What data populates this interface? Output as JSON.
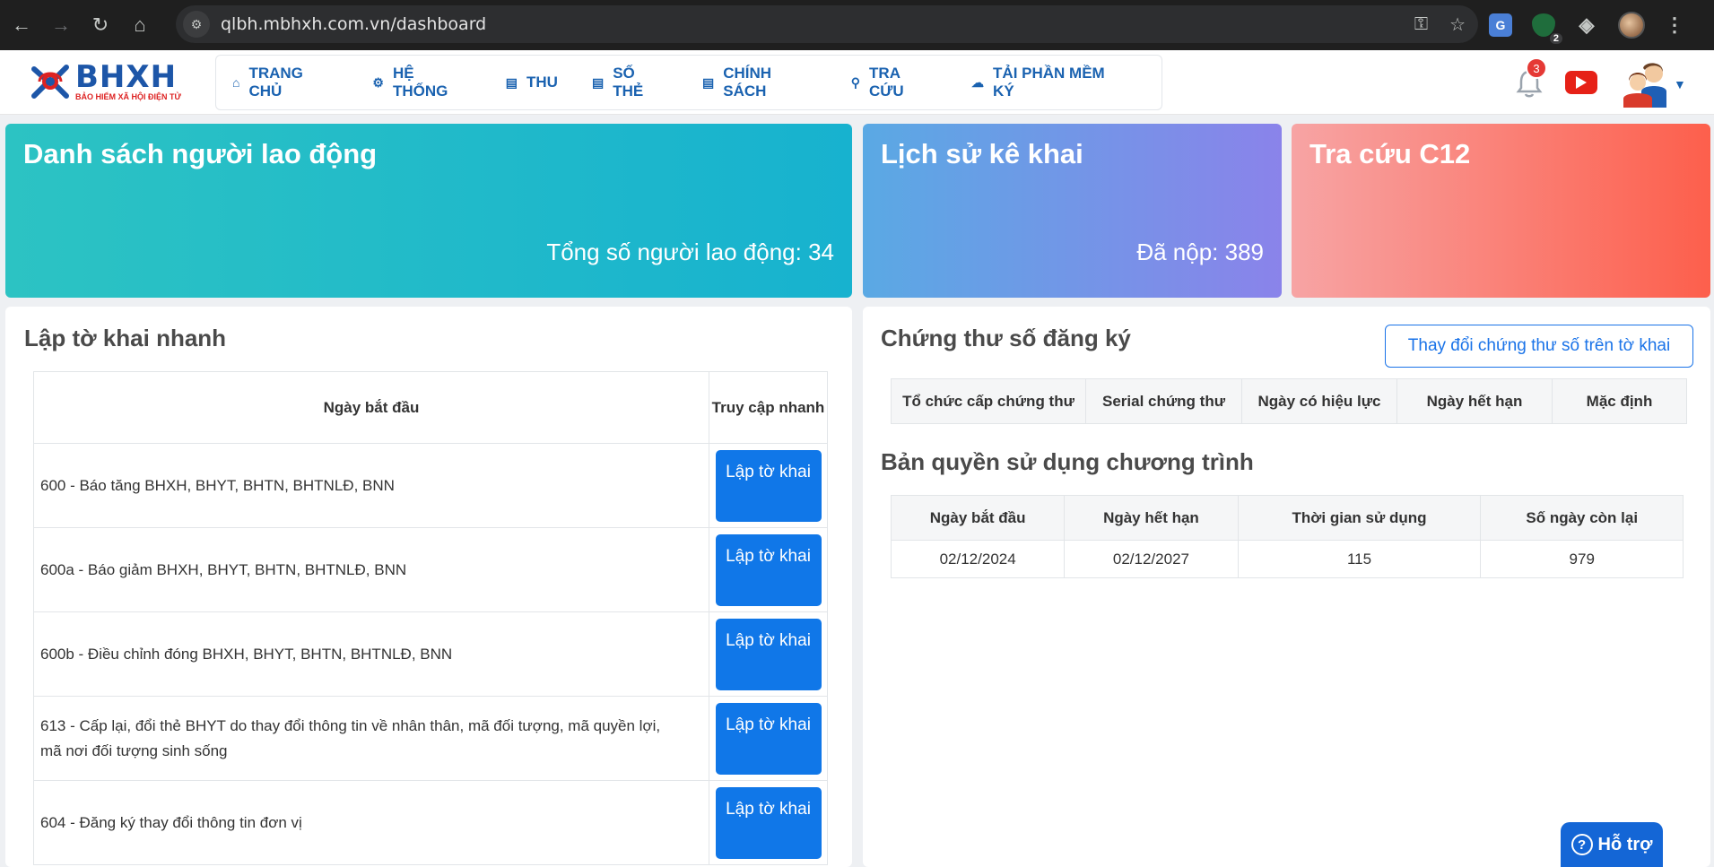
{
  "browser": {
    "url": "qlbh.mbhxh.com.vn/dashboard",
    "extension_badge": "2"
  },
  "header": {
    "logo_text": "BHXH",
    "logo_subtext": "BẢO HIỂM XÃ HỘI ĐIỆN TỬ",
    "menu": [
      {
        "label": "TRANG CHỦ",
        "icon": "home-icon"
      },
      {
        "label": "HỆ THỐNG",
        "icon": "gear-icon"
      },
      {
        "label": "THU",
        "icon": "document-icon"
      },
      {
        "label": "SỐ THẺ",
        "icon": "document-icon"
      },
      {
        "label": "CHÍNH SÁCH",
        "icon": "document-icon"
      },
      {
        "label": "TRA CỨU",
        "icon": "search-icon"
      },
      {
        "label": "TẢI PHẦN MỀM KÝ",
        "icon": "cloud-upload-icon"
      }
    ],
    "notification_count": "3"
  },
  "cards": {
    "workers": {
      "title": "Danh sách người lao động",
      "value": "Tổng số người lao động: 34"
    },
    "history": {
      "title": "Lịch sử kê khai",
      "value": "Đã nộp: 389"
    },
    "c12": {
      "title": "Tra cứu C12"
    }
  },
  "quick_form": {
    "title": "Lập tờ khai nhanh",
    "col_name": "Ngày bắt đầu",
    "col_action": "Truy cập nhanh",
    "button_label": "Lập tờ khai",
    "rows": [
      "600 - Báo tăng BHXH, BHYT, BHTN, BHTNLĐ, BNN",
      "600a - Báo giảm BHXH, BHYT, BHTN, BHTNLĐ, BNN",
      "600b - Điều chỉnh đóng BHXH, BHYT, BHTN, BHTNLĐ, BNN",
      "613 - Cấp lại, đổi thẻ BHYT do thay đổi thông tin về nhân thân, mã đối tượng, mã quyền lợi, mã nơi đối tượng sinh sống",
      "604 - Đăng ký thay đổi thông tin đơn vị"
    ]
  },
  "certificate": {
    "title": "Chứng thư số đăng ký",
    "change_button": "Thay đổi chứng thư số trên tờ khai",
    "columns": [
      "Tổ chức cấp chứng thư",
      "Serial chứng thư",
      "Ngày có hiệu lực",
      "Ngày hết hạn",
      "Mặc định"
    ]
  },
  "license": {
    "title": "Bản quyền sử dụng chương trình",
    "columns": [
      "Ngày bắt đầu",
      "Ngày hết hạn",
      "Thời gian sử dụng",
      "Số ngày còn lại"
    ],
    "values": [
      "02/12/2024",
      "02/12/2027",
      "115",
      "979"
    ]
  },
  "support": {
    "label": "Hỗ trợ"
  }
}
